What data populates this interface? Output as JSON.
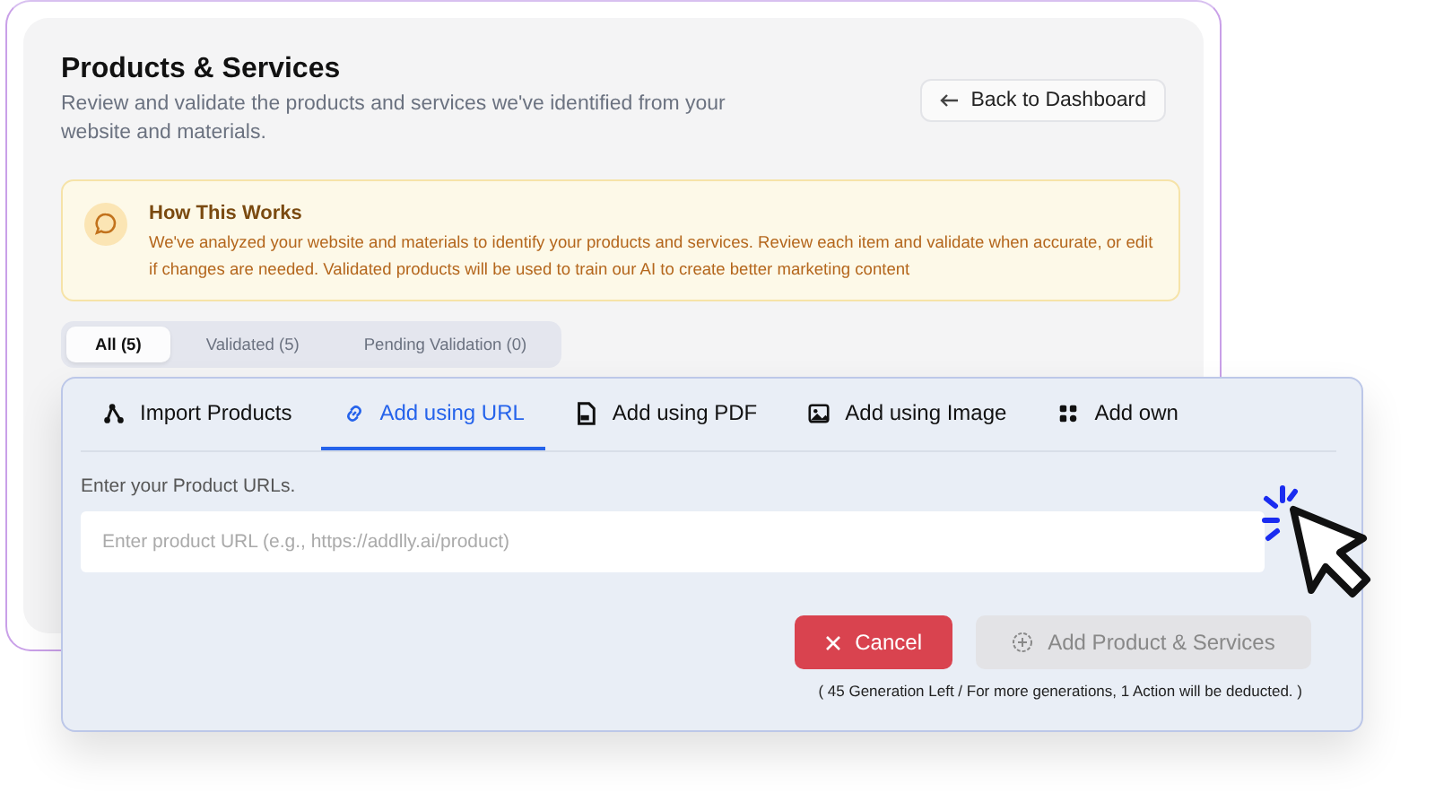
{
  "header": {
    "title": "Products & Services",
    "subtitle": "Review and validate the products and services we've identified from your website and materials.",
    "back_button": "Back to Dashboard"
  },
  "info": {
    "title": "How This Works",
    "text": "We've analyzed your website and materials to identify your products and services. Review each item and validate when accurate, or edit if changes are needed. Validated products will be used to train our AI to create better marketing content"
  },
  "filter_tabs": [
    {
      "label": "All (5)",
      "selected": true
    },
    {
      "label": "Validated (5)",
      "selected": false
    },
    {
      "label": "Pending Validation (0)",
      "selected": false
    }
  ],
  "modal": {
    "tabs": [
      {
        "label": "Import Products",
        "kind": "import",
        "selected": false
      },
      {
        "label": "Add using URL",
        "kind": "url",
        "selected": true
      },
      {
        "label": "Add using PDF",
        "kind": "pdf",
        "selected": false
      },
      {
        "label": "Add using Image",
        "kind": "image",
        "selected": false
      },
      {
        "label": "Add own",
        "kind": "own",
        "selected": false
      }
    ],
    "field_label": "Enter your Product URLs.",
    "url_input": {
      "placeholder": "Enter product URL (e.g., https://addlly.ai/product)"
    },
    "cancel_button": "Cancel",
    "add_button": {
      "label": "Add Product & Services",
      "disabled": true
    },
    "note": "( 45 Generation Left / For more generations, 1 Action will be deducted. )"
  }
}
